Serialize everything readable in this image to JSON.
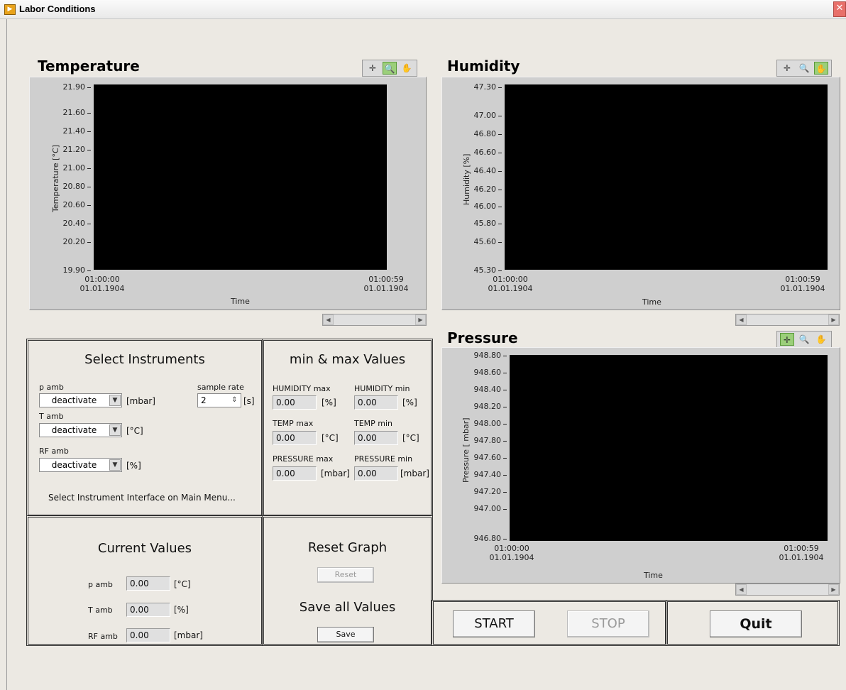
{
  "window": {
    "title": "Labor Conditions",
    "close": "✕",
    "app_icon": "▶"
  },
  "toolbar_icons": [
    "cursor-icon",
    "zoom-icon",
    "pan-hand-icon"
  ],
  "charts": {
    "temperature": {
      "title": "Temperature",
      "ylabel": "Temperature [°C]",
      "xlabel": "Time",
      "yticks": [
        "21.90",
        "21.60",
        "21.40",
        "21.20",
        "21.00",
        "20.80",
        "20.60",
        "20.40",
        "20.20",
        "19.90"
      ],
      "xstart_time": "01:00:00",
      "xstart_date": "01.01.1904",
      "xend_time": "01:00:59",
      "xend_date": "01.01.1904"
    },
    "humidity": {
      "title": "Humidity",
      "ylabel": "Humidity [%]",
      "xlabel": "Time",
      "yticks": [
        "47.30",
        "47.00",
        "46.80",
        "46.60",
        "46.40",
        "46.20",
        "46.00",
        "45.80",
        "45.60",
        "45.30"
      ],
      "xstart_time": "01:00:00",
      "xstart_date": "01.01.1904",
      "xend_time": "01:00:59",
      "xend_date": "01.01.1904"
    },
    "pressure": {
      "title": "Pressure",
      "ylabel": "Pressure [ mbar]",
      "xlabel": "Time",
      "yticks": [
        "948.80",
        "948.60",
        "948.40",
        "948.20",
        "948.00",
        "947.80",
        "947.60",
        "947.40",
        "947.20",
        "947.00",
        "946.80"
      ],
      "xstart_time": "01:00:00",
      "xstart_date": "01.01.1904",
      "xend_time": "01:00:59",
      "xend_date": "01.01.1904"
    }
  },
  "select_instruments": {
    "title": "Select Instruments",
    "p_amb_label": "p amb",
    "p_amb_value": "deactivate",
    "p_amb_unit": "[mbar]",
    "t_amb_label": "T amb",
    "t_amb_value": "deactivate",
    "t_amb_unit": "[°C]",
    "rf_amb_label": "RF amb",
    "rf_amb_value": "deactivate",
    "rf_amb_unit": "[%]",
    "sample_rate_label": "sample rate",
    "sample_rate_value": "2",
    "sample_rate_unit": "[s]",
    "hint": "Select Instrument Interface on Main Menu..."
  },
  "min_max": {
    "title": "min & max Values",
    "humidity_max_label": "HUMIDITY max",
    "humidity_max_value": "0.00",
    "humidity_max_unit": "[%]",
    "humidity_min_label": "HUMIDITY min",
    "humidity_min_value": "0.00",
    "humidity_min_unit": "[%]",
    "temp_max_label": "TEMP max",
    "temp_max_value": "0.00",
    "temp_max_unit": "[°C]",
    "temp_min_label": "TEMP min",
    "temp_min_value": "0.00",
    "temp_min_unit": "[°C]",
    "pressure_max_label": "PRESSURE max",
    "pressure_max_value": "0.00",
    "pressure_max_unit": "[mbar]",
    "pressure_min_label": "PRESSURE min",
    "pressure_min_value": "0.00",
    "pressure_min_unit": "[mbar]"
  },
  "current_values": {
    "title": "Current Values",
    "p_amb_label": "p amb",
    "p_amb_value": "0.00",
    "p_amb_unit": "[°C]",
    "t_amb_label": "T amb",
    "t_amb_value": "0.00",
    "t_amb_unit": "[%]",
    "rf_amb_label": "RF amb",
    "rf_amb_value": "0.00",
    "rf_amb_unit": "[mbar]"
  },
  "reset_save": {
    "reset_title": "Reset Graph",
    "reset_label": "Reset",
    "save_title": "Save all Values",
    "save_label": "Save"
  },
  "controls": {
    "start_label": "START",
    "stop_label": "STOP",
    "quit_label": "Quit"
  }
}
